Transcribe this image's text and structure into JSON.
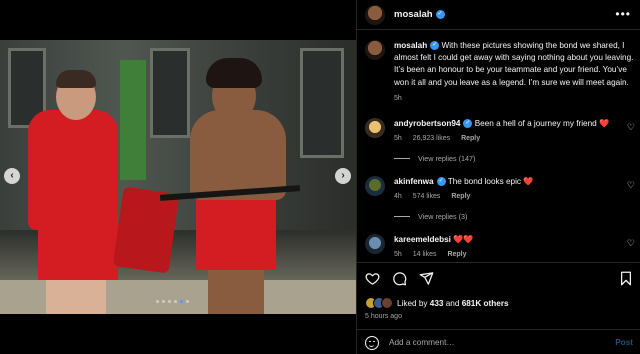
{
  "post": {
    "author": "mosalah",
    "caption": "With these pictures showing the bond we shared, I almost felt I could get away with saying nothing about you leaving. It’s been an honour to be your teammate and your friend. You’ve won it all and you leave as a legend. I’m sure we will meet again.",
    "caption_time": "5h"
  },
  "media": {
    "prev_icon": "‹",
    "next_icon": "›",
    "slide_count": 6,
    "active_slide": 4
  },
  "comments": [
    {
      "username": "andyrobertson94",
      "verified": true,
      "text": "Been a hell of a journey my friend ❤️",
      "time": "5h",
      "likes": "26,923 likes",
      "reply": "Reply",
      "view_replies": "View replies (147)"
    },
    {
      "username": "akinfenwa",
      "verified": true,
      "text": "The bond looks epic ❤️",
      "time": "4h",
      "likes": "574 likes",
      "reply": "Reply",
      "view_replies": "View replies (3)"
    },
    {
      "username": "kareemeldebsi",
      "verified": false,
      "text": "❤️❤️",
      "time": "5h",
      "likes": "14 likes",
      "reply": "Reply"
    }
  ],
  "engagement": {
    "liked_by_prefix": "Liked by",
    "liked_by_user": "433",
    "and_text": "and",
    "others_text": "681K others",
    "time_ago": "5 hours ago"
  },
  "add_comment": {
    "placeholder": "Add a comment…",
    "post_label": "Post"
  },
  "icons": {
    "more": "more-horizontal-icon",
    "like": "heart-icon",
    "comment": "comment-icon",
    "share": "share-icon",
    "save": "bookmark-icon",
    "emoji": "emoji-icon"
  },
  "colors": {
    "verified": "#3897f0",
    "post_button": "#1f4f7a",
    "muted_text": "#a8a8a8"
  }
}
